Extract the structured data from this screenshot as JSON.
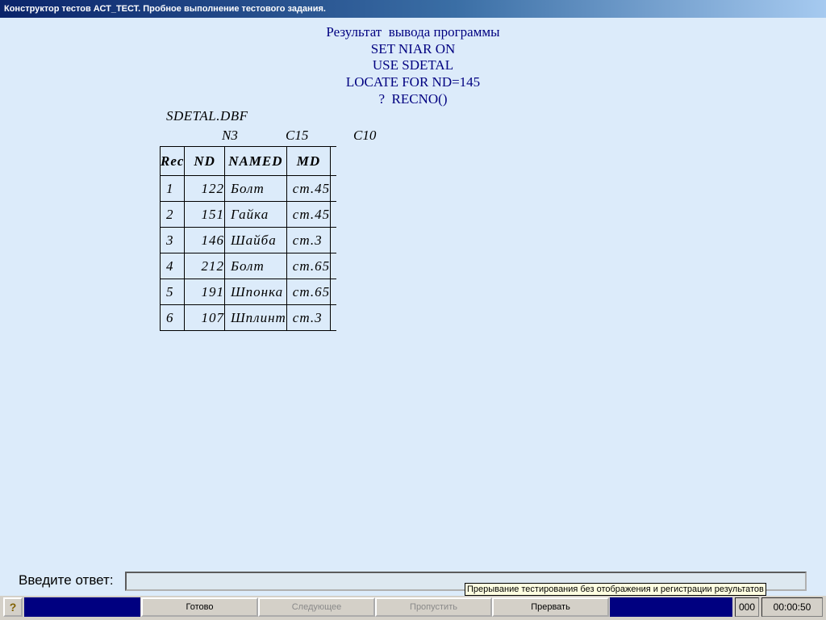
{
  "window": {
    "title": "Конструктор тестов АСТ_ТЕСТ. Пробное выполнение тестового задания."
  },
  "question": {
    "lines": [
      "Результат  вывода программы",
      "SET NIAR ON",
      "USE SDETAL",
      "LOCATE FOR ND=145",
      "?  RECNO()"
    ]
  },
  "dbf": {
    "name": "SDETAL.DBF",
    "types": [
      "N3",
      "C15",
      "C10"
    ],
    "headers": [
      "Rec",
      "ND",
      "NAMED",
      "MD"
    ],
    "rows": [
      [
        "1",
        "122",
        "Болт",
        "ст.45"
      ],
      [
        "2",
        "151",
        "Гайка",
        "ст.45"
      ],
      [
        "3",
        "146",
        "Шайба",
        "ст.3"
      ],
      [
        "4",
        "212",
        "Болт",
        "ст.65"
      ],
      [
        "5",
        "191",
        "Шпонка",
        "ст.65"
      ],
      [
        "6",
        "107",
        "Шплинт",
        "ст.3"
      ]
    ]
  },
  "answer": {
    "label": "Введите ответ:",
    "value": ""
  },
  "tooltip": "Прерывание тестирования без отображения и регистрации результатов",
  "toolbar": {
    "help_icon": "?",
    "done_label": "Готово",
    "next_label": "Следующее",
    "skip_label": "Пропустить",
    "abort_label": "Прервать"
  },
  "status": {
    "counter": "000",
    "timer": "00:00:50"
  }
}
